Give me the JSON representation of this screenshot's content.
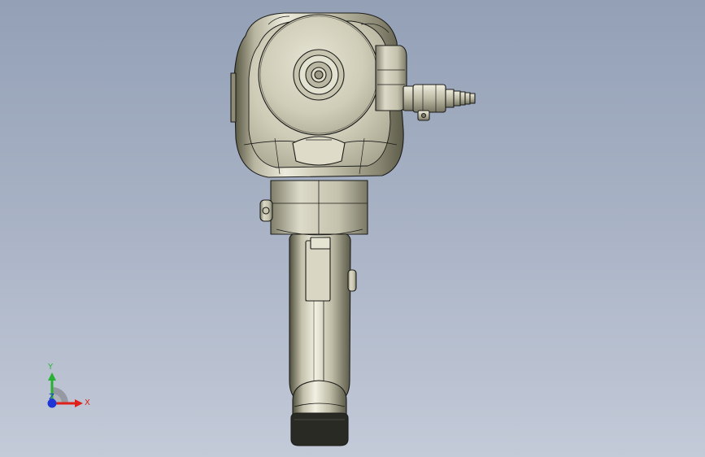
{
  "viewport": {
    "background_top": "#93a0b6",
    "background_bottom": "#c3cad8"
  },
  "model": {
    "name_icon": "impact-wrench-model",
    "body_color": "#c9c7b2",
    "shade_color": "#7d7b69",
    "edge_color": "#1c1c1a"
  },
  "triad": {
    "x_label": "X",
    "y_label": "Y",
    "z_label": "Z",
    "x_color": "#e0201b",
    "y_color": "#27b233",
    "z_color": "#1e35d8"
  }
}
